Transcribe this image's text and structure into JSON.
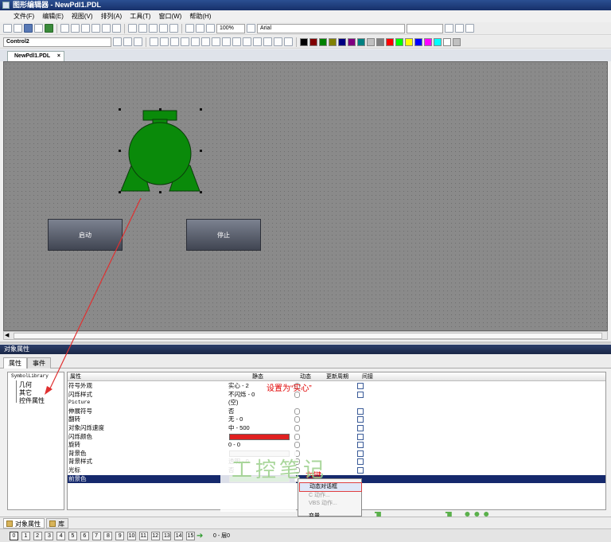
{
  "window": {
    "title": "图形编辑器 - NewPdl1.PDL"
  },
  "menu": [
    "文件(F)",
    "编辑(E)",
    "视图(V)",
    "排列(A)",
    "工具(T)",
    "窗口(W)",
    "帮助(H)"
  ],
  "toolbar": {
    "zoom": "100%",
    "font": "Arial",
    "control_name": "Control2",
    "palette": [
      "#000000",
      "#800000",
      "#008000",
      "#808000",
      "#000080",
      "#800080",
      "#008080",
      "#c0c0c0",
      "#808080",
      "#ff0000",
      "#00ff00",
      "#ffff00",
      "#0000ff",
      "#ff00ff",
      "#00ffff",
      "#ffffff",
      "#c0c0c0"
    ]
  },
  "document": {
    "tab_label": "NewPdl1.PDL",
    "close": "×"
  },
  "canvas": {
    "buttons": [
      {
        "label": "启动"
      },
      {
        "label": "停止"
      }
    ],
    "motor_color": "#0a8a0a"
  },
  "properties_panel": {
    "title": "对象属性",
    "tabs": [
      "属性",
      "事件"
    ],
    "tree": {
      "root": "SymbolLibrary",
      "items": [
        "几何",
        "其它",
        "控件属性"
      ]
    },
    "columns": [
      "属性",
      "静态",
      "动态",
      "更新周期",
      "间接"
    ],
    "rows": [
      {
        "name": "符号外观",
        "value": "实心 - 2"
      },
      {
        "name": "闪烁样式",
        "value": "不闪烁 - 0"
      },
      {
        "name": "Picture",
        "value": "(空)"
      },
      {
        "name": "伸展符号",
        "value": "否"
      },
      {
        "name": "翻转",
        "value": "无 - 0"
      },
      {
        "name": "对象闪烁速度",
        "value": "中 - 500"
      },
      {
        "name": "闪烁颜色",
        "value": ""
      },
      {
        "name": "旋转",
        "value": "0 - 0"
      },
      {
        "name": "背景色",
        "value": ""
      },
      {
        "name": "背景样式",
        "value": "透明 - 0"
      },
      {
        "name": "光标",
        "value": "否"
      },
      {
        "name": "前景色",
        "value": ""
      }
    ],
    "colors": {
      "flash": "#e02020",
      "background": "#d8d8d8",
      "foreground": "#2a9a2a"
    }
  },
  "context_menu": {
    "items": [
      "动态对话框",
      "C 动作...",
      "VBS 动作...",
      "变量",
      "删除"
    ]
  },
  "annotations": {
    "set_solid": "设置为“实心”",
    "right_click": "右键"
  },
  "watermark": {
    "cn": "工控笔记",
    "url": "www.gongkongbiji.com"
  },
  "bottom_tabs": [
    "对象属性",
    "库"
  ],
  "status": {
    "layers": [
      "0",
      "1",
      "2",
      "3",
      "4",
      "5",
      "6",
      "7",
      "8",
      "9",
      "10",
      "11",
      "12",
      "13",
      "14",
      "15"
    ],
    "layer_text": "0 - 层0"
  }
}
